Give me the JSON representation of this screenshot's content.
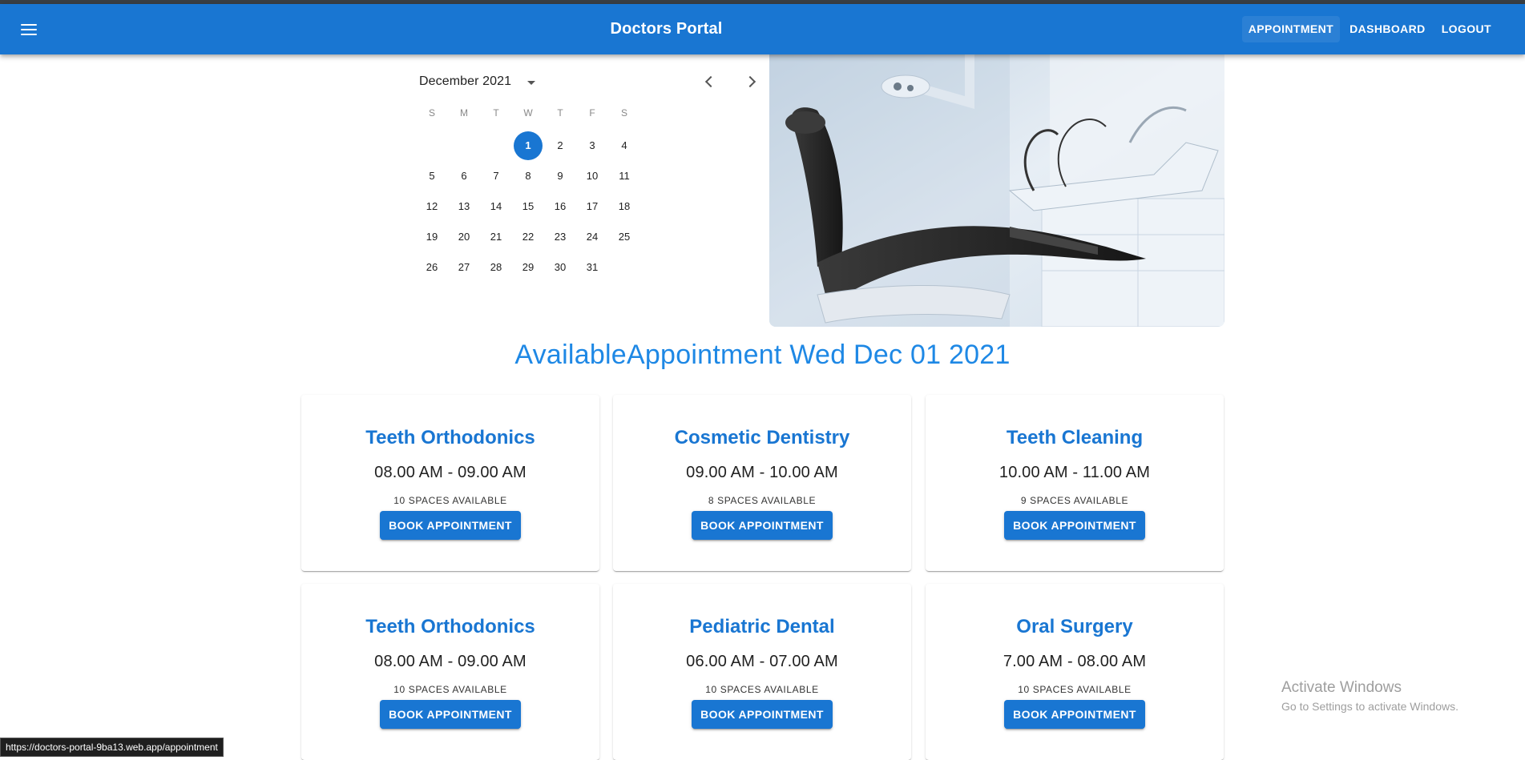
{
  "app": {
    "title": "Doctors Portal",
    "nav": [
      {
        "label": "APPOINTMENT",
        "active": true
      },
      {
        "label": "DASHBOARD",
        "active": false
      },
      {
        "label": "LOGOUT",
        "active": false
      }
    ]
  },
  "calendar": {
    "month_label": "December 2021",
    "weekdays": [
      "S",
      "M",
      "T",
      "W",
      "T",
      "F",
      "S"
    ],
    "first_weekday_index": 3,
    "days_in_month": 31,
    "selected_day": 1
  },
  "heading": "AvailableAppointment Wed Dec 01 2021",
  "appointments": [
    {
      "name": "Teeth Orthodonics",
      "time": "08.00 AM - 09.00 AM",
      "spaces": "10 SPACES AVAILABLE",
      "button": "BOOK APPOINTMENT"
    },
    {
      "name": "Cosmetic Dentistry",
      "time": "09.00 AM - 10.00 AM",
      "spaces": "8 SPACES AVAILABLE",
      "button": "BOOK APPOINTMENT"
    },
    {
      "name": "Teeth Cleaning",
      "time": "10.00 AM - 11.00 AM",
      "spaces": "9 SPACES AVAILABLE",
      "button": "BOOK APPOINTMENT"
    },
    {
      "name": "Teeth Orthodonics",
      "time": "08.00 AM - 09.00 AM",
      "spaces": "10 SPACES AVAILABLE",
      "button": "BOOK APPOINTMENT"
    },
    {
      "name": "Pediatric Dental",
      "time": "06.00 AM - 07.00 AM",
      "spaces": "10 SPACES AVAILABLE",
      "button": "BOOK APPOINTMENT"
    },
    {
      "name": "Oral Surgery",
      "time": "7.00 AM - 08.00 AM",
      "spaces": "10 SPACES AVAILABLE",
      "button": "BOOK APPOINTMENT"
    }
  ],
  "watermark": {
    "title": "Activate Windows",
    "subtitle": "Go to Settings to activate Windows."
  },
  "status_url": "https://doctors-portal-9ba13.web.app/appointment",
  "colors": {
    "primary": "#1976d2",
    "heading": "#1e88e5"
  },
  "icons": {
    "menu": "hamburger-menu-icon",
    "month_dropdown": "arrow-drop-down-icon",
    "prev": "chevron-left-icon",
    "next": "chevron-right-icon"
  }
}
